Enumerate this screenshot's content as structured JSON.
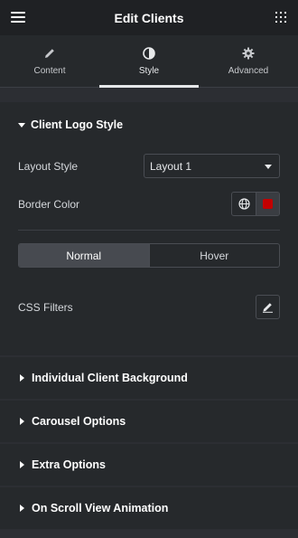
{
  "header": {
    "title": "Edit Clients"
  },
  "tabs": [
    {
      "label": "Content",
      "icon": "pencil-icon"
    },
    {
      "label": "Style",
      "icon": "contrast-icon"
    },
    {
      "label": "Advanced",
      "icon": "gear-icon"
    }
  ],
  "active_tab": "Style",
  "section": {
    "title": "Client Logo Style",
    "layout_style": {
      "label": "Layout Style",
      "value": "Layout 1"
    },
    "border_color": {
      "label": "Border Color",
      "swatch": "#c20000"
    },
    "state_toggle": {
      "normal": "Normal",
      "hover": "Hover",
      "active": "Normal"
    },
    "css_filters": {
      "label": "CSS Filters"
    }
  },
  "collapsed_sections": [
    {
      "title": "Individual Client Background"
    },
    {
      "title": "Carousel Options"
    },
    {
      "title": "Extra Options"
    },
    {
      "title": "On Scroll View Animation"
    }
  ]
}
